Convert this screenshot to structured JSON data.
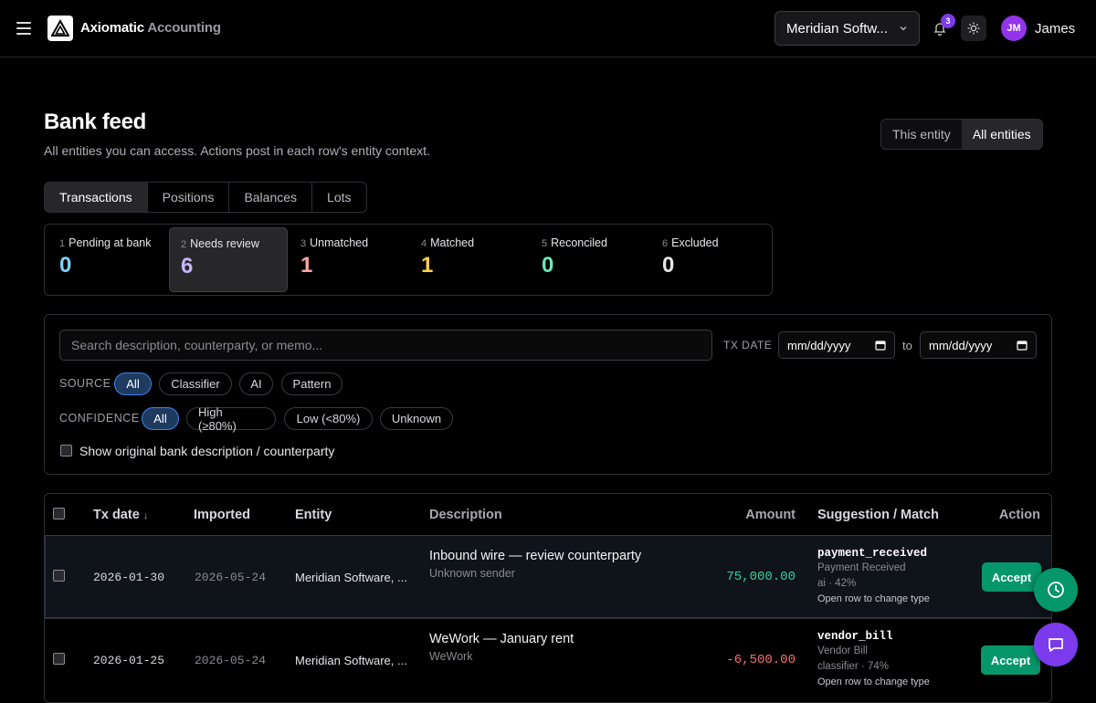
{
  "header": {
    "brand_main": "Axiomatic",
    "brand_sub": "Accounting",
    "entity_selector": "Meridian Softw...",
    "notifications_count": "3",
    "user_initials": "JM",
    "user_name": "James"
  },
  "page": {
    "title": "Bank feed",
    "subtitle": "All entities you can access. Actions post in each row's entity context.",
    "scope": [
      {
        "label": "This entity",
        "active": false
      },
      {
        "label": "All entities",
        "active": true
      }
    ]
  },
  "tabs": [
    {
      "label": "Transactions",
      "active": true
    },
    {
      "label": "Positions",
      "active": false
    },
    {
      "label": "Balances",
      "active": false
    },
    {
      "label": "Lots",
      "active": false
    }
  ],
  "statuses": [
    {
      "num": "1",
      "label": "Pending at bank",
      "value": "0",
      "color": "#7dd3fc"
    },
    {
      "num": "2",
      "label": "Needs review",
      "value": "6",
      "color": "#c4b5fd",
      "active": true
    },
    {
      "num": "3",
      "label": "Unmatched",
      "value": "1",
      "color": "#fca5a5"
    },
    {
      "num": "4",
      "label": "Matched",
      "value": "1",
      "color": "#fcd34d"
    },
    {
      "num": "5",
      "label": "Reconciled",
      "value": "0",
      "color": "#6ee7b7"
    },
    {
      "num": "6",
      "label": "Excluded",
      "value": "0",
      "color": "#e4e4e7"
    }
  ],
  "filters": {
    "search_placeholder": "Search description, counterparty, or memo...",
    "txdate_label": "TX DATE",
    "date_from": "mm/dd/yyyy",
    "to_label": "to",
    "date_to": "mm/dd/yyyy",
    "source_label": "SOURCE",
    "source_chips": [
      "All",
      "Classifier",
      "AI",
      "Pattern"
    ],
    "confidence_label": "CONFIDENCE",
    "confidence_chips": [
      "All",
      "High (≥80%)",
      "Low (<80%)",
      "Unknown"
    ],
    "show_original_label": "Show original bank description / counterparty"
  },
  "table": {
    "headers": {
      "txdate": "Tx date",
      "sort": "↓",
      "imported": "Imported",
      "entity": "Entity",
      "description": "Description",
      "amount": "Amount",
      "suggestion": "Suggestion / Match",
      "action": "Action"
    },
    "rows": [
      {
        "txdate": "2026-01-30",
        "imported": "2026-05-24",
        "entity": "Meridian Software, ...",
        "desc": "Inbound wire — review counterparty",
        "counterparty": "Unknown sender",
        "amount": "75,000.00",
        "amount_color": "#34d399",
        "sugg_code": "payment_received",
        "sugg_name": "Payment Received",
        "sugg_meta": "ai · 42%",
        "sugg_hint": "Open row to change type",
        "action": "Accept"
      },
      {
        "txdate": "2026-01-25",
        "imported": "2026-05-24",
        "entity": "Meridian Software, ...",
        "desc": "WeWork — January rent",
        "counterparty": "WeWork",
        "amount": "-6,500.00",
        "amount_color": "#f87171",
        "sugg_code": "vendor_bill",
        "sugg_name": "Vendor Bill",
        "sugg_meta": "classifier · 74%",
        "sugg_hint": "Open row to change type",
        "action": "Accept"
      }
    ]
  },
  "fabs": {
    "history_color": "#059669",
    "chat_color": "#7c3aed"
  }
}
